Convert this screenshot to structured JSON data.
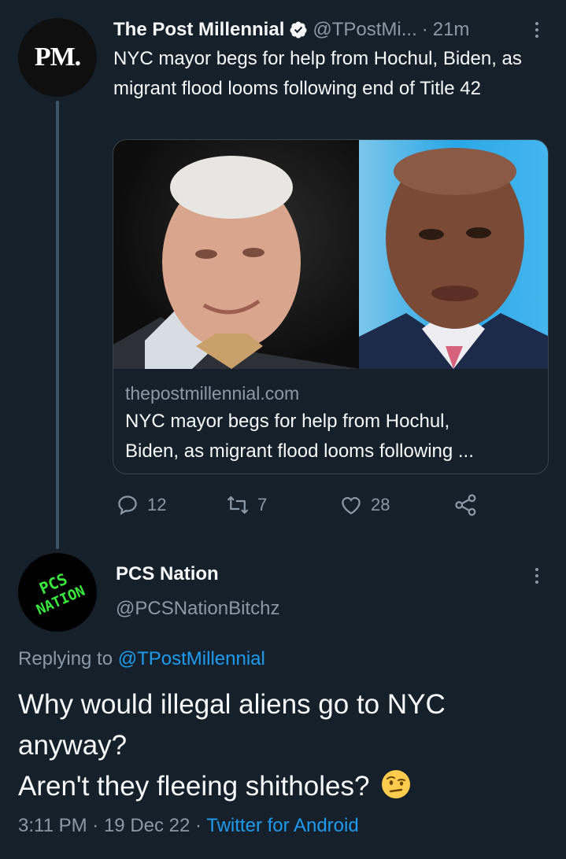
{
  "tweet1": {
    "avatar_text": "PM.",
    "name": "The Post Millennial",
    "handle": "@TPostMi...",
    "sep": "·",
    "time": "21m",
    "text": "NYC mayor begs for help from Hochul, Biden, as migrant flood looms following end of Title 42",
    "card": {
      "domain": "thepostmillennial.com",
      "title_line1": "NYC mayor begs for help from Hochul,",
      "title_line2": "Biden, as migrant flood looms following ..."
    },
    "actions": {
      "reply_count": "12",
      "retweet_count": "7",
      "like_count": "28"
    }
  },
  "tweet2": {
    "avatar_line1": "PCS",
    "avatar_line2": "NATION",
    "name": "PCS Nation",
    "handle": "@PCSNationBitchz",
    "replying_prefix": "Replying to",
    "replying_handle": "@TPostMillennial",
    "body_line1": "Why would illegal aliens go to NYC",
    "body_line2": "anyway?",
    "body_line3": "Aren't they fleeing shitholes?",
    "time": "3:11 PM",
    "date": "19 Dec 22",
    "sep": "·",
    "source": "Twitter for Android"
  },
  "icons": {
    "verified": "verified-badge-icon",
    "reply": "reply-icon",
    "retweet": "retweet-icon",
    "like": "heart-icon",
    "share": "share-icon",
    "more": "more-icon",
    "emoji": "raised-eyebrow-emoji"
  },
  "colors": {
    "background": "#15202b",
    "text": "#f7f9f9",
    "muted": "#8b98a5",
    "link": "#1d9bf0",
    "border": "#38444d",
    "logo_green": "#39e93d"
  }
}
